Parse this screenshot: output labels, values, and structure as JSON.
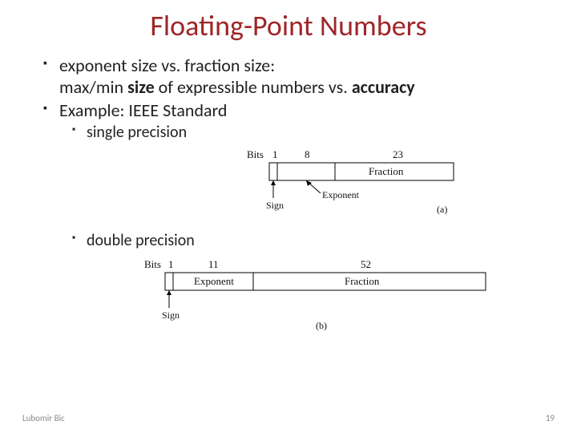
{
  "title": "Floating-Point Numbers",
  "bullets": {
    "b1_line1": "exponent size vs. fraction size:",
    "b1_line2_pre": "max/min ",
    "b1_line2_bold1": "size",
    "b1_line2_mid": " of expressible numbers vs. ",
    "b1_line2_bold2": "accuracy",
    "b2": "Example: IEEE Standard",
    "sub1": "single precision",
    "sub2": "double precision"
  },
  "diagram_single": {
    "bits_label": "Bits",
    "sign_bits": "1",
    "exp_bits": "8",
    "frac_bits": "23",
    "sign_label": "Sign",
    "exp_label": "Exponent",
    "frac_label": "Fraction",
    "caption": "(a)"
  },
  "diagram_double": {
    "bits_label": "Bits",
    "sign_bits": "1",
    "exp_bits": "11",
    "frac_bits": "52",
    "sign_label": "Sign",
    "exp_label": "Exponent",
    "frac_label": "Fraction",
    "caption": "(b)"
  },
  "footer": {
    "author": "Lubomir Bic",
    "page": "19"
  },
  "chart_data": [
    {
      "type": "table",
      "title": "IEEE single precision field widths (bits)",
      "categories": [
        "Sign",
        "Exponent",
        "Fraction"
      ],
      "values": [
        1,
        8,
        23
      ]
    },
    {
      "type": "table",
      "title": "IEEE double precision field widths (bits)",
      "categories": [
        "Sign",
        "Exponent",
        "Fraction"
      ],
      "values": [
        1,
        11,
        52
      ]
    }
  ]
}
